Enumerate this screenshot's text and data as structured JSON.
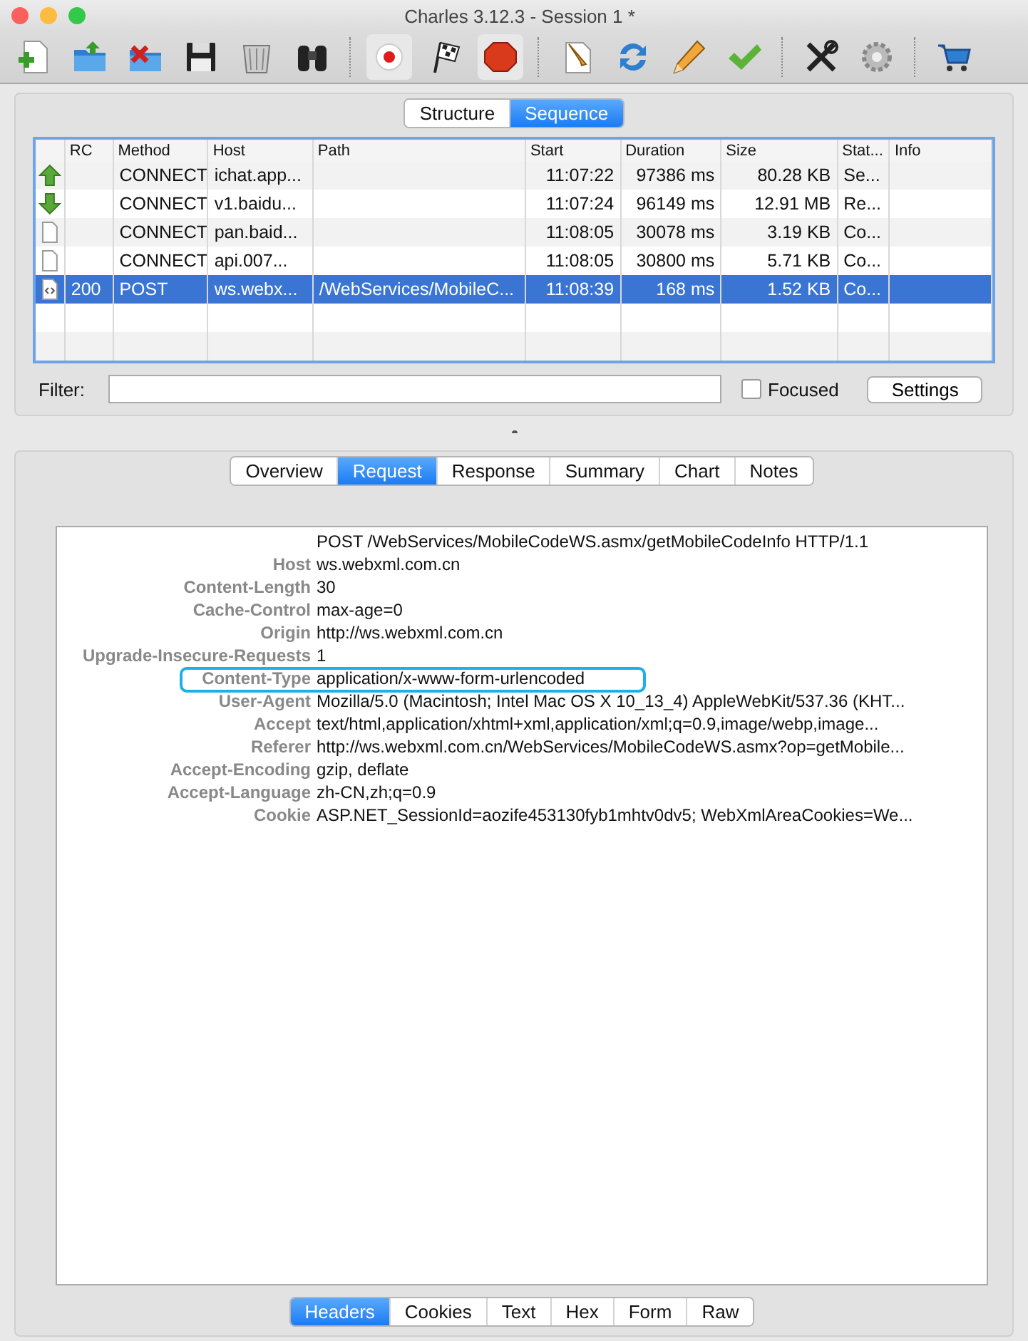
{
  "window": {
    "title": "Charles 3.12.3 - Session 1 *"
  },
  "toolbar": [
    {
      "kind": "new",
      "pressed": false
    },
    {
      "kind": "open",
      "pressed": false
    },
    {
      "kind": "close",
      "pressed": false
    },
    {
      "kind": "save",
      "pressed": false
    },
    {
      "kind": "trash",
      "pressed": false
    },
    {
      "kind": "find",
      "pressed": false
    },
    {
      "kind": "sep"
    },
    {
      "kind": "record",
      "pressed": true
    },
    {
      "kind": "flag",
      "pressed": false
    },
    {
      "kind": "stop",
      "pressed": true
    },
    {
      "kind": "sep"
    },
    {
      "kind": "edit",
      "pressed": false
    },
    {
      "kind": "repeat",
      "pressed": false
    },
    {
      "kind": "pencil",
      "pressed": false
    },
    {
      "kind": "check",
      "pressed": false
    },
    {
      "kind": "sep"
    },
    {
      "kind": "tools",
      "pressed": false
    },
    {
      "kind": "gear",
      "pressed": false
    },
    {
      "kind": "sep"
    },
    {
      "kind": "cart",
      "pressed": false
    }
  ],
  "view_tabs": [
    {
      "label": "Structure",
      "selected": false
    },
    {
      "label": "Sequence",
      "selected": true
    }
  ],
  "table": {
    "columns": [
      "RC",
      "Method",
      "Host",
      "Path",
      "Start",
      "Duration",
      "Size",
      "Stat...",
      "Info"
    ],
    "rows": [
      {
        "kind": "upload",
        "rc": null,
        "method": "CONNECT",
        "host": "ichat.app...",
        "path": null,
        "start": "11:07:22",
        "duration": "97386 ms",
        "size": "80.28 KB",
        "status": "Se...",
        "selected": false
      },
      {
        "kind": "download",
        "rc": null,
        "method": "CONNECT",
        "host": "v1.baidu...",
        "path": null,
        "start": "11:07:24",
        "duration": "96149 ms",
        "size": "12.91 MB",
        "status": "Re...",
        "selected": false
      },
      {
        "kind": "file",
        "rc": null,
        "method": "CONNECT",
        "host": "pan.baid...",
        "path": null,
        "start": "11:08:05",
        "duration": "30078 ms",
        "size": "3.19 KB",
        "status": "Co...",
        "selected": false
      },
      {
        "kind": "file",
        "rc": null,
        "method": "CONNECT",
        "host": "api.007...",
        "path": null,
        "start": "11:08:05",
        "duration": "30800 ms",
        "size": "5.71 KB",
        "status": "Co...",
        "selected": false
      },
      {
        "kind": "markup",
        "rc": "200",
        "method": "POST",
        "host": "ws.webx...",
        "path": "/WebServices/MobileC...",
        "start": "11:08:39",
        "duration": "168 ms",
        "size": "1.52 KB",
        "status": "Co...",
        "selected": true
      }
    ]
  },
  "filter": {
    "label": "Filter:",
    "focused_label": "Focused",
    "focused": false,
    "settings_button": "Settings"
  },
  "detail_tabs": [
    {
      "label": "Overview",
      "selected": false
    },
    {
      "label": "Request",
      "selected": true
    },
    {
      "label": "Response",
      "selected": false
    },
    {
      "label": "Summary",
      "selected": false
    },
    {
      "label": "Chart",
      "selected": false
    },
    {
      "label": "Notes",
      "selected": false
    }
  ],
  "request": {
    "request_line": "POST  /WebServices/MobileCodeWS.asmx/getMobileCodeInfo HTTP/1.1",
    "headers": [
      {
        "name": "Host",
        "value": "ws.webxml.com.cn",
        "highlighted": false
      },
      {
        "name": "Content-Length",
        "value": "30",
        "highlighted": false
      },
      {
        "name": "Cache-Control",
        "value": "max-age=0",
        "highlighted": false
      },
      {
        "name": "Origin",
        "value": "http://ws.webxml.com.cn",
        "highlighted": false
      },
      {
        "name": "Upgrade-Insecure-Requests",
        "value": "1",
        "highlighted": false
      },
      {
        "name": "Content-Type",
        "value": "application/x-www-form-urlencoded",
        "highlighted": true
      },
      {
        "name": "User-Agent",
        "value": "Mozilla/5.0 (Macintosh; Intel Mac OS X 10_13_4) AppleWebKit/537.36 (KHT...",
        "highlighted": false
      },
      {
        "name": "Accept",
        "value": "text/html,application/xhtml+xml,application/xml;q=0.9,image/webp,image...",
        "highlighted": false
      },
      {
        "name": "Referer",
        "value": "http://ws.webxml.com.cn/WebServices/MobileCodeWS.asmx?op=getMobile...",
        "highlighted": false
      },
      {
        "name": "Accept-Encoding",
        "value": "gzip, deflate",
        "highlighted": false
      },
      {
        "name": "Accept-Language",
        "value": "zh-CN,zh;q=0.9",
        "highlighted": false
      },
      {
        "name": "Cookie",
        "value": "ASP.NET_SessionId=aozife453130fyb1mhtv0dv5; WebXmlAreaCookies=We...",
        "highlighted": false
      }
    ]
  },
  "format_tabs": [
    {
      "label": "Headers",
      "selected": true
    },
    {
      "label": "Cookies",
      "selected": false
    },
    {
      "label": "Text",
      "selected": false
    },
    {
      "label": "Hex",
      "selected": false
    },
    {
      "label": "Form",
      "selected": false
    },
    {
      "label": "Raw",
      "selected": false
    }
  ]
}
